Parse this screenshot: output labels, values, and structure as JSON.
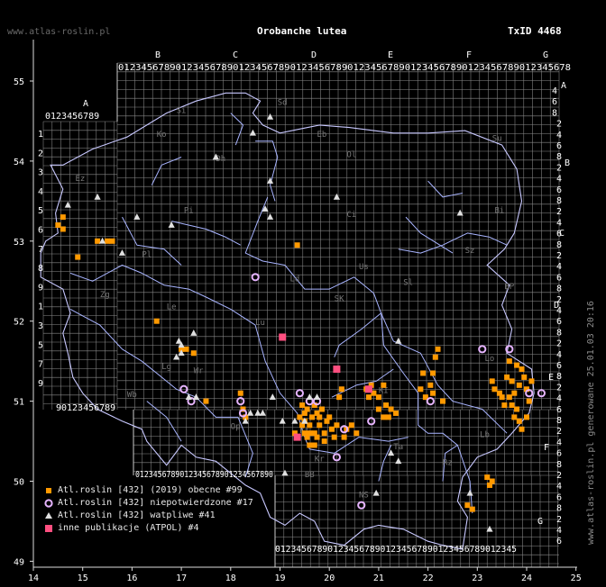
{
  "header": {
    "site": "www.atlas-roslin.pl",
    "title": "Orobanche lutea",
    "taxid": "TxID 4468"
  },
  "credit": "www.atlas-roslin.pl generowane 25.01.03 20:16",
  "colors": {
    "grid": "#8a8a8a",
    "border": "#c8c8ff",
    "rivers": "#a8b4ff",
    "orange": "#ff9900",
    "pink": "#ff4f80",
    "circle_stroke": "#e6b4ff",
    "triangle": "#e0e0e0",
    "zone_label": "#777777"
  },
  "axes": {
    "x_ticks": [
      "14",
      "15",
      "16",
      "17",
      "18",
      "19",
      "20",
      "21",
      "22",
      "23",
      "24",
      "25"
    ],
    "y_ticks": [
      "55",
      "54",
      "53",
      "52",
      "51",
      "50",
      "49"
    ]
  },
  "atpol": {
    "top_letters": [
      "B",
      "C",
      "D",
      "E",
      "F",
      "G"
    ],
    "a_letter": "A",
    "top_digits": "0123456789012345678901234567890123456789012345678901234567890123456789012345678",
    "a_digits": "0123456789",
    "bottom_digits_1": "0123456789012345678901234567890",
    "bottom_digits_2": "0123456789012345678901234567890123456789012345",
    "left_digits_1": [
      "1",
      "2",
      "3",
      "4",
      "5",
      "6",
      "7",
      "8",
      "9",
      "1",
      "3",
      "5",
      "7",
      "9"
    ],
    "left_digits_2": [
      "1",
      "2",
      "3",
      "4",
      "5",
      "6",
      "7",
      "8",
      "9"
    ],
    "right_letters": [
      "A",
      "B",
      "C",
      "D",
      "E",
      "F",
      "G"
    ],
    "right_digits": [
      "4",
      "6",
      "8",
      "2",
      "4",
      "6",
      "8",
      "2",
      "4",
      "6",
      "8",
      "2",
      "4",
      "6",
      "8",
      "2",
      "4",
      "6",
      "8",
      "2",
      "4",
      "6",
      "8",
      "2",
      "4",
      "6",
      "8",
      "2",
      "4",
      "6",
      "8",
      "2",
      "4",
      "6",
      "8",
      "2",
      "4",
      "6",
      "8",
      "2",
      "4",
      "6",
      "8"
    ],
    "bottom_right_digits": [
      "4",
      "6",
      "8",
      "2",
      "4",
      "6",
      "8"
    ]
  },
  "zone_labels": [
    "Si",
    "Sd",
    "Ko",
    "Eb",
    "Su",
    "Ol",
    "Dh",
    "Ez",
    "Pi",
    "Bi",
    "Ci",
    "Sz",
    "Us",
    "Pl",
    "Ld",
    "Sl",
    "BP",
    "Zg",
    "SK",
    "Le",
    "Lo",
    "Lu",
    "Lg",
    "Wr",
    "Wb",
    "KI",
    "Lb",
    "Op",
    "Kr",
    "Kt",
    "Ta",
    "BB",
    "NS",
    "Rz"
  ],
  "legend": {
    "items": [
      {
        "kind": "square",
        "label": "Atl.roslin [432] (2019) obecne #99"
      },
      {
        "kind": "circle",
        "label": "Atl.roslin [432] niepotwierdzone #17"
      },
      {
        "kind": "triangle",
        "label": "Atl.roslin [432] watpliwe #41"
      },
      {
        "kind": "pink",
        "label": "inne publikacje (ATPOL) #4"
      }
    ]
  },
  "records": {
    "present_squares": [
      [
        14.5,
        53.2
      ],
      [
        14.6,
        53.3
      ],
      [
        14.6,
        53.15
      ],
      [
        14.9,
        52.8
      ],
      [
        15.3,
        53.0
      ],
      [
        15.5,
        53.0
      ],
      [
        15.6,
        53.0
      ],
      [
        16.5,
        52.0
      ],
      [
        17.0,
        51.65
      ],
      [
        17.1,
        51.65
      ],
      [
        17.25,
        51.6
      ],
      [
        17.5,
        51.0
      ],
      [
        18.2,
        51.1
      ],
      [
        18.25,
        50.9
      ],
      [
        18.3,
        50.8
      ],
      [
        19.35,
        52.95
      ],
      [
        19.3,
        50.6
      ],
      [
        19.4,
        50.8
      ],
      [
        19.45,
        50.95
      ],
      [
        19.5,
        50.85
      ],
      [
        19.55,
        50.9
      ],
      [
        19.6,
        50.7
      ],
      [
        19.65,
        50.8
      ],
      [
        19.7,
        50.95
      ],
      [
        19.75,
        50.85
      ],
      [
        19.8,
        50.7
      ],
      [
        19.55,
        50.55
      ],
      [
        19.6,
        50.6
      ],
      [
        19.45,
        50.7
      ],
      [
        19.5,
        50.75
      ],
      [
        19.7,
        50.6
      ],
      [
        19.8,
        50.8
      ],
      [
        19.85,
        50.9
      ],
      [
        19.9,
        50.6
      ],
      [
        19.95,
        50.75
      ],
      [
        20.0,
        50.8
      ],
      [
        20.05,
        50.65
      ],
      [
        20.15,
        50.7
      ],
      [
        20.2,
        51.05
      ],
      [
        20.3,
        50.55
      ],
      [
        20.35,
        50.65
      ],
      [
        20.45,
        50.7
      ],
      [
        20.55,
        50.6
      ],
      [
        20.75,
        51.15
      ],
      [
        20.8,
        51.05
      ],
      [
        20.9,
        51.1
      ],
      [
        20.85,
        51.2
      ],
      [
        21.0,
        51.05
      ],
      [
        21.1,
        51.2
      ],
      [
        21.0,
        50.9
      ],
      [
        21.1,
        50.8
      ],
      [
        21.15,
        50.95
      ],
      [
        21.2,
        50.8
      ],
      [
        21.25,
        50.9
      ],
      [
        21.35,
        50.85
      ],
      [
        21.85,
        51.15
      ],
      [
        21.9,
        51.35
      ],
      [
        21.95,
        51.05
      ],
      [
        22.05,
        51.2
      ],
      [
        22.1,
        51.35
      ],
      [
        22.15,
        51.55
      ],
      [
        22.2,
        51.65
      ],
      [
        22.1,
        51.1
      ],
      [
        22.3,
        51.0
      ],
      [
        23.3,
        51.25
      ],
      [
        23.35,
        51.15
      ],
      [
        23.45,
        51.1
      ],
      [
        23.6,
        51.3
      ],
      [
        23.7,
        51.25
      ],
      [
        23.65,
        51.05
      ],
      [
        23.7,
        50.95
      ],
      [
        23.8,
        50.9
      ],
      [
        23.75,
        51.1
      ],
      [
        23.85,
        51.2
      ],
      [
        23.9,
        51.4
      ],
      [
        23.95,
        51.3
      ],
      [
        24.0,
        51.15
      ],
      [
        24.05,
        51.0
      ],
      [
        24.1,
        51.25
      ],
      [
        23.8,
        51.45
      ],
      [
        23.65,
        51.5
      ],
      [
        23.85,
        50.75
      ],
      [
        23.9,
        50.65
      ],
      [
        24.0,
        50.8
      ],
      [
        23.2,
        50.05
      ],
      [
        23.3,
        50.0
      ],
      [
        23.25,
        49.95
      ],
      [
        22.9,
        49.65
      ],
      [
        22.8,
        49.7
      ],
      [
        23.5,
        51.05
      ],
      [
        23.55,
        50.95
      ],
      [
        23.75,
        50.8
      ],
      [
        19.9,
        50.5
      ],
      [
        19.7,
        50.45
      ],
      [
        19.6,
        50.45
      ],
      [
        19.75,
        50.55
      ],
      [
        19.5,
        50.6
      ],
      [
        20.1,
        50.55
      ],
      [
        20.25,
        51.15
      ]
    ],
    "unconfirmed_circles": [
      [
        18.5,
        52.55
      ],
      [
        17.05,
        51.15
      ],
      [
        17.2,
        51.0
      ],
      [
        18.2,
        51.0
      ],
      [
        18.25,
        50.85
      ],
      [
        19.4,
        51.1
      ],
      [
        19.6,
        51.0
      ],
      [
        19.75,
        51.0
      ],
      [
        20.3,
        50.65
      ],
      [
        20.15,
        50.3
      ],
      [
        20.85,
        50.75
      ],
      [
        22.05,
        51.0
      ],
      [
        23.1,
        51.65
      ],
      [
        23.65,
        51.65
      ],
      [
        24.05,
        51.1
      ],
      [
        24.3,
        51.1
      ],
      [
        20.65,
        49.7
      ]
    ],
    "doubtful_triangles": [
      [
        18.8,
        54.55
      ],
      [
        18.45,
        54.35
      ],
      [
        17.7,
        54.05
      ],
      [
        18.8,
        53.75
      ],
      [
        20.15,
        53.55
      ],
      [
        14.7,
        53.45
      ],
      [
        15.3,
        53.55
      ],
      [
        16.1,
        53.3
      ],
      [
        16.8,
        53.2
      ],
      [
        18.7,
        53.4
      ],
      [
        18.8,
        53.3
      ],
      [
        15.4,
        53.0
      ],
      [
        15.8,
        52.85
      ],
      [
        17.0,
        51.7
      ],
      [
        17.25,
        51.85
      ],
      [
        16.95,
        51.75
      ],
      [
        16.9,
        51.55
      ],
      [
        17.0,
        51.6
      ],
      [
        17.15,
        51.05
      ],
      [
        17.3,
        51.05
      ],
      [
        18.4,
        50.85
      ],
      [
        18.3,
        50.75
      ],
      [
        18.55,
        50.85
      ],
      [
        18.65,
        50.85
      ],
      [
        18.85,
        51.05
      ],
      [
        19.05,
        50.75
      ],
      [
        19.3,
        50.75
      ],
      [
        19.5,
        50.75
      ],
      [
        19.1,
        50.1
      ],
      [
        19.6,
        51.05
      ],
      [
        19.75,
        51.05
      ],
      [
        21.4,
        51.75
      ],
      [
        21.4,
        50.25
      ],
      [
        21.25,
        50.35
      ],
      [
        22.65,
        53.35
      ],
      [
        23.25,
        49.4
      ],
      [
        22.85,
        49.85
      ],
      [
        20.95,
        49.85
      ]
    ],
    "publication_pink": [
      [
        19.05,
        51.8
      ],
      [
        20.15,
        51.4
      ],
      [
        20.8,
        51.15
      ],
      [
        19.35,
        50.55
      ]
    ]
  },
  "outline": [
    [
      14.25,
      53.0
    ],
    [
      14.5,
      53.1
    ],
    [
      14.45,
      53.35
    ],
    [
      14.6,
      53.65
    ],
    [
      14.35,
      53.95
    ],
    [
      14.6,
      53.95
    ],
    [
      15.2,
      54.15
    ],
    [
      15.9,
      54.3
    ],
    [
      16.3,
      54.45
    ],
    [
      16.7,
      54.6
    ],
    [
      17.3,
      54.75
    ],
    [
      17.9,
      54.85
    ],
    [
      18.3,
      54.85
    ],
    [
      18.6,
      54.75
    ],
    [
      18.45,
      54.6
    ],
    [
      18.65,
      54.45
    ],
    [
      19.0,
      54.35
    ],
    [
      19.4,
      54.4
    ],
    [
      19.8,
      54.45
    ],
    [
      20.4,
      54.42
    ],
    [
      21.3,
      54.35
    ],
    [
      22.0,
      54.35
    ],
    [
      22.75,
      54.38
    ],
    [
      23.5,
      54.2
    ],
    [
      23.8,
      53.9
    ],
    [
      23.9,
      53.5
    ],
    [
      23.75,
      53.1
    ],
    [
      23.55,
      52.9
    ],
    [
      23.2,
      52.7
    ],
    [
      23.65,
      52.45
    ],
    [
      23.5,
      52.2
    ],
    [
      23.7,
      51.9
    ],
    [
      23.6,
      51.6
    ],
    [
      24.1,
      51.4
    ],
    [
      24.15,
      51.1
    ],
    [
      24.05,
      50.85
    ],
    [
      23.7,
      50.6
    ],
    [
      23.4,
      50.4
    ],
    [
      23.0,
      50.3
    ],
    [
      22.7,
      50.05
    ],
    [
      22.6,
      49.75
    ],
    [
      22.8,
      49.55
    ],
    [
      22.7,
      49.15
    ],
    [
      22.3,
      49.2
    ],
    [
      22.0,
      49.25
    ],
    [
      21.5,
      49.4
    ],
    [
      21.0,
      49.45
    ],
    [
      20.7,
      49.4
    ],
    [
      20.3,
      49.2
    ],
    [
      19.9,
      49.25
    ],
    [
      19.7,
      49.5
    ],
    [
      19.4,
      49.6
    ],
    [
      19.1,
      49.45
    ],
    [
      18.8,
      49.55
    ],
    [
      18.6,
      49.85
    ],
    [
      18.3,
      49.95
    ],
    [
      18.0,
      50.1
    ],
    [
      17.7,
      50.25
    ],
    [
      17.3,
      50.3
    ],
    [
      17.0,
      50.45
    ],
    [
      16.7,
      50.2
    ],
    [
      16.3,
      50.5
    ],
    [
      16.2,
      50.65
    ],
    [
      15.8,
      50.75
    ],
    [
      15.3,
      50.9
    ],
    [
      15.0,
      51.1
    ],
    [
      14.8,
      51.3
    ],
    [
      14.7,
      51.6
    ],
    [
      14.6,
      51.85
    ],
    [
      14.75,
      52.1
    ],
    [
      14.6,
      52.4
    ],
    [
      14.15,
      52.55
    ],
    [
      14.15,
      52.85
    ],
    [
      14.25,
      53.0
    ]
  ],
  "rivers": [
    [
      [
        18.75,
        53.55
      ],
      [
        18.55,
        53.25
      ],
      [
        18.3,
        52.85
      ],
      [
        18.65,
        52.75
      ],
      [
        19.1,
        52.7
      ],
      [
        19.5,
        52.4
      ],
      [
        20.0,
        52.4
      ],
      [
        20.5,
        52.55
      ],
      [
        20.9,
        52.35
      ],
      [
        21.05,
        52.1
      ],
      [
        21.1,
        51.7
      ],
      [
        21.5,
        51.35
      ],
      [
        21.8,
        51.1
      ],
      [
        21.8,
        50.7
      ],
      [
        22.0,
        50.6
      ],
      [
        22.3,
        50.6
      ],
      [
        22.6,
        50.45
      ],
      [
        22.85,
        50.0
      ],
      [
        22.9,
        49.6
      ]
    ],
    [
      [
        18.5,
        54.25
      ],
      [
        18.85,
        54.25
      ],
      [
        18.95,
        54.05
      ],
      [
        18.8,
        53.7
      ],
      [
        18.9,
        53.5
      ]
    ],
    [
      [
        21.05,
        52.1
      ],
      [
        21.3,
        51.75
      ],
      [
        21.85,
        51.6
      ],
      [
        22.2,
        51.2
      ],
      [
        22.5,
        51.0
      ],
      [
        23.1,
        50.9
      ],
      [
        23.6,
        50.6
      ]
    ],
    [
      [
        21.4,
        52.9
      ],
      [
        21.85,
        52.85
      ],
      [
        22.3,
        52.95
      ],
      [
        22.8,
        53.1
      ],
      [
        23.25,
        53.05
      ],
      [
        23.6,
        52.95
      ]
    ],
    [
      [
        21.55,
        53.3
      ],
      [
        21.85,
        53.1
      ],
      [
        22.5,
        52.85
      ]
    ],
    [
      [
        22.0,
        53.75
      ],
      [
        22.3,
        53.55
      ],
      [
        22.7,
        53.6
      ]
    ],
    [
      [
        18.3,
        50.05
      ],
      [
        18.45,
        50.35
      ],
      [
        18.15,
        50.8
      ],
      [
        17.7,
        50.8
      ],
      [
        17.3,
        51.05
      ],
      [
        16.9,
        51.15
      ],
      [
        16.5,
        51.35
      ],
      [
        16.2,
        51.5
      ],
      [
        15.8,
        51.65
      ],
      [
        15.35,
        51.95
      ],
      [
        15.05,
        52.05
      ],
      [
        14.75,
        52.15
      ]
    ],
    [
      [
        14.75,
        52.6
      ],
      [
        15.2,
        52.5
      ],
      [
        15.8,
        52.7
      ],
      [
        16.2,
        52.6
      ],
      [
        16.65,
        52.45
      ],
      [
        17.15,
        52.4
      ],
      [
        17.5,
        52.3
      ],
      [
        18.0,
        52.15
      ],
      [
        18.5,
        51.95
      ],
      [
        18.7,
        51.5
      ],
      [
        19.0,
        51.1
      ],
      [
        19.35,
        50.85
      ],
      [
        19.5,
        50.55
      ],
      [
        19.6,
        50.4
      ]
    ],
    [
      [
        16.8,
        53.25
      ],
      [
        17.5,
        53.15
      ],
      [
        17.9,
        53.05
      ],
      [
        18.2,
        52.95
      ]
    ],
    [
      [
        15.8,
        53.3
      ],
      [
        16.1,
        52.95
      ],
      [
        16.65,
        52.9
      ],
      [
        17.0,
        52.7
      ]
    ],
    [
      [
        19.6,
        50.4
      ],
      [
        20.1,
        50.35
      ],
      [
        20.6,
        50.55
      ],
      [
        21.2,
        50.5
      ],
      [
        21.6,
        50.55
      ]
    ],
    [
      [
        20.05,
        51.05
      ],
      [
        20.55,
        51.2
      ],
      [
        20.95,
        51.25
      ],
      [
        21.3,
        51.4
      ]
    ],
    [
      [
        20.1,
        51.55
      ],
      [
        20.2,
        51.7
      ],
      [
        20.65,
        51.9
      ],
      [
        21.05,
        52.1
      ]
    ],
    [
      [
        21.0,
        50.0
      ],
      [
        21.1,
        50.25
      ],
      [
        21.25,
        50.45
      ]
    ],
    [
      [
        22.3,
        50.0
      ],
      [
        22.35,
        50.35
      ],
      [
        22.6,
        50.45
      ]
    ],
    [
      [
        17.0,
        50.5
      ],
      [
        16.7,
        50.8
      ],
      [
        16.3,
        51.0
      ]
    ],
    [
      [
        18.0,
        54.6
      ],
      [
        18.25,
        54.45
      ],
      [
        18.1,
        54.2
      ]
    ],
    [
      [
        16.4,
        53.7
      ],
      [
        16.6,
        53.95
      ],
      [
        17.0,
        54.05
      ]
    ]
  ]
}
